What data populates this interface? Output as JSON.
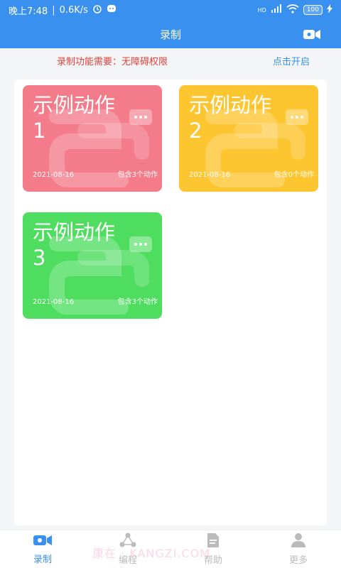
{
  "status_bar": {
    "time": "晚上7:48",
    "speed": "0.6K/s",
    "network": "HD",
    "battery": "100"
  },
  "header": {
    "title": "录制"
  },
  "notice": {
    "message": "录制功能需要：无障碍权限",
    "action": "点击开启"
  },
  "cards": [
    {
      "name": "示例动作1",
      "date": "2021-08-16",
      "count": "包含3个动作",
      "color": "#f37b8a"
    },
    {
      "name": "示例动作2",
      "date": "2021-08-16",
      "count": "包含0个动作",
      "color": "#fdc52f"
    },
    {
      "name": "示例动作3",
      "date": "2021-08-16",
      "count": "包含3个动作",
      "color": "#4fdd60"
    }
  ],
  "tabs": [
    {
      "label": "录制",
      "icon": "video-camera-icon",
      "active": true
    },
    {
      "label": "编程",
      "icon": "share-nodes-icon",
      "active": false
    },
    {
      "label": "帮助",
      "icon": "document-icon",
      "active": false
    },
    {
      "label": "更多",
      "icon": "person-icon",
      "active": false
    }
  ],
  "watermark": "康在 · KANGZI.COM",
  "colors": {
    "primary": "#3a90ee",
    "warning": "#e0443e",
    "inactive": "#bbbbbb"
  }
}
